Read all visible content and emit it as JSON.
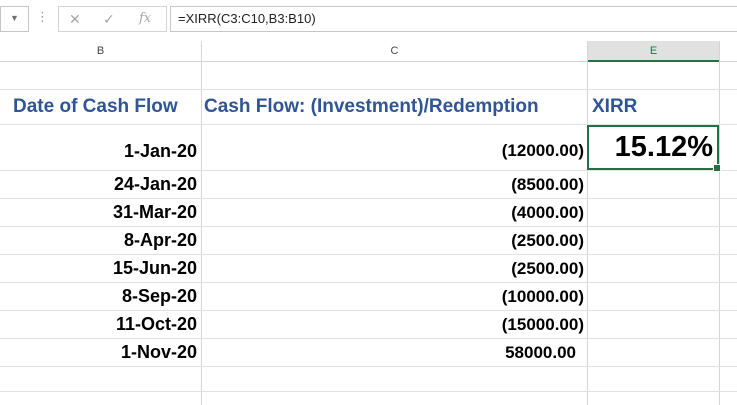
{
  "formula_bar": {
    "formula": "=XIRR(C3:C10,B3:B10)",
    "fx_label": "fx"
  },
  "columns": {
    "b": "B",
    "c": "C",
    "e": "E"
  },
  "headers": {
    "date": "Date of Cash Flow",
    "cashflow": "Cash Flow: (Investment)/Redemption",
    "xirr": "XIRR"
  },
  "rows": [
    {
      "date": "1-Jan-20",
      "amount": "(12000.00)"
    },
    {
      "date": "24-Jan-20",
      "amount": "(8500.00)"
    },
    {
      "date": "31-Mar-20",
      "amount": "(4000.00)"
    },
    {
      "date": "8-Apr-20",
      "amount": "(2500.00)"
    },
    {
      "date": "15-Jun-20",
      "amount": "(2500.00)"
    },
    {
      "date": "8-Sep-20",
      "amount": "(10000.00)"
    },
    {
      "date": "11-Oct-20",
      "amount": "(15000.00)"
    },
    {
      "date": "1-Nov-20",
      "amount": "58000.00"
    }
  ],
  "result": {
    "xirr": "15.12%"
  },
  "colors": {
    "header_text": "#2f5597",
    "selection": "#217346"
  }
}
